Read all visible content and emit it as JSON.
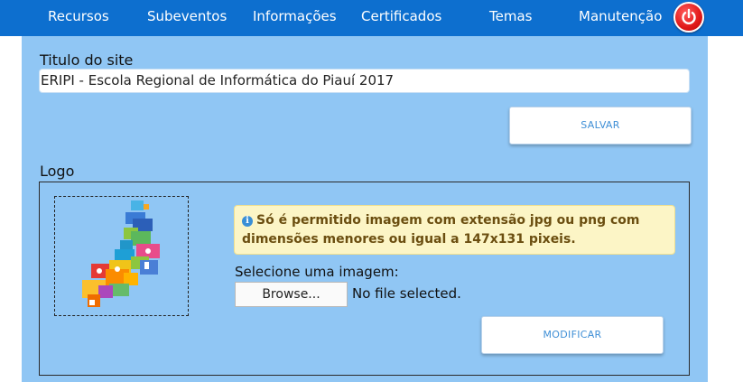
{
  "nav": {
    "items": [
      {
        "label": "Recursos"
      },
      {
        "label": "Subeventos"
      },
      {
        "label": "Informações"
      },
      {
        "label": "Certificados"
      },
      {
        "label": "Temas"
      },
      {
        "label": "Manutenção"
      }
    ],
    "power_icon": "power-icon"
  },
  "site_title": {
    "label": "Titulo do site",
    "value": "ERIPI - Escola Regional de Informática do Piauí 2017",
    "save_button": "SALVAR"
  },
  "logo": {
    "label": "Logo",
    "alert_icon": "info-icon",
    "alert_line1": "Só é permitido imagem com extensão jpg ou png com",
    "alert_line2": "dimensões menores ou igual a 147x131 pixeis.",
    "select_label": "Selecione uma imagem:",
    "browse_label": "Browse...",
    "file_status": "No file selected.",
    "modify_button": "MODIFICAR"
  },
  "colors": {
    "nav_bg": "#0d6fcf",
    "panel_bg": "#90c6f4",
    "button_text": "#3f8fd6",
    "power": "#e01818",
    "alert_bg": "#fcf5c6"
  }
}
